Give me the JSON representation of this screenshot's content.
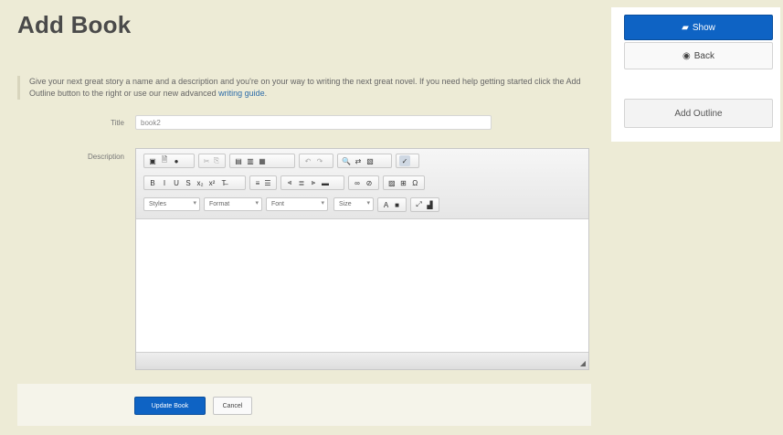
{
  "page": {
    "title": "Add Book",
    "intro_text": "Give your next great story a name and a description and you're on your way to writing the next great novel. If you need help getting started click the Add Outline button to the right or use our new advanced ",
    "intro_link": "writing guide",
    "intro_end": "."
  },
  "form": {
    "title_label": "Title",
    "title_value": "book2",
    "description_label": "Description"
  },
  "editor": {
    "toolbar_row1": [
      {
        "name": "source-icon",
        "glyph": "▣"
      },
      {
        "name": "save-icon",
        "glyph": "🗎"
      },
      {
        "name": "preview-icon",
        "glyph": "●"
      },
      {
        "name": "cut-icon",
        "glyph": "✂"
      },
      {
        "name": "copy-icon",
        "glyph": "⎘"
      },
      {
        "name": "paste-icon",
        "glyph": "▤"
      },
      {
        "name": "paste-text-icon",
        "glyph": "▥"
      },
      {
        "name": "paste-word-icon",
        "glyph": "▦"
      },
      {
        "name": "undo-icon",
        "glyph": "↶"
      },
      {
        "name": "redo-icon",
        "glyph": "↷"
      },
      {
        "name": "find-icon",
        "glyph": "🔍"
      },
      {
        "name": "replace-icon",
        "glyph": "⇄"
      },
      {
        "name": "select-all-icon",
        "glyph": "▧"
      },
      {
        "name": "spellcheck-icon",
        "glyph": "✓"
      }
    ],
    "toolbar_row2": [
      {
        "name": "bold-icon",
        "glyph": "B"
      },
      {
        "name": "italic-icon",
        "glyph": "I"
      },
      {
        "name": "underline-icon",
        "glyph": "U"
      },
      {
        "name": "strikethrough-icon",
        "glyph": "S"
      },
      {
        "name": "subscript-icon",
        "glyph": "x₂"
      },
      {
        "name": "superscript-icon",
        "glyph": "x²"
      },
      {
        "name": "remove-format-icon",
        "glyph": "T̶"
      },
      {
        "name": "numbered-list-icon",
        "glyph": "≡"
      },
      {
        "name": "bulleted-list-icon",
        "glyph": "☰"
      },
      {
        "name": "align-left-icon",
        "glyph": "⫷"
      },
      {
        "name": "align-center-icon",
        "glyph": "≣"
      },
      {
        "name": "align-right-icon",
        "glyph": "⫸"
      },
      {
        "name": "justify-icon",
        "glyph": "▬"
      },
      {
        "name": "link-icon",
        "glyph": "∞"
      },
      {
        "name": "unlink-icon",
        "glyph": "⊘"
      },
      {
        "name": "image-icon",
        "glyph": "▨"
      },
      {
        "name": "table-icon",
        "glyph": "⊞"
      },
      {
        "name": "special-char-icon",
        "glyph": "Ω"
      }
    ],
    "styles_label": "Styles",
    "format_label": "Format",
    "font_label": "Font",
    "size_label": "Size",
    "toolbar_row3_icons": [
      {
        "name": "text-color-icon",
        "glyph": "A"
      },
      {
        "name": "bg-color-icon",
        "glyph": "■"
      },
      {
        "name": "maximize-icon",
        "glyph": "⤢"
      },
      {
        "name": "show-blocks-icon",
        "glyph": "▟"
      }
    ]
  },
  "actions": {
    "update_label": "Update Book",
    "cancel_label": "Cancel"
  },
  "sidebar": {
    "show_label": "Show",
    "back_label": "Back",
    "add_outline_label": "Add Outline"
  },
  "colors": {
    "primary": "#0e63c4",
    "background": "#edebd6",
    "link": "#2d6ca8"
  }
}
